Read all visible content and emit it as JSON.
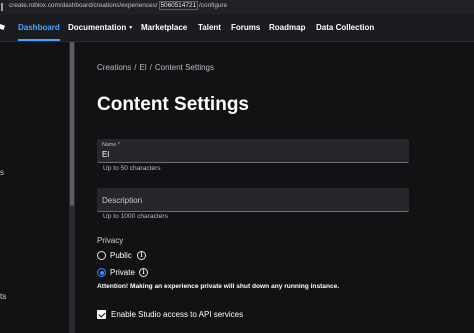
{
  "browser": {
    "url_prefix": "create.roblox.com/dashboard/creations/experiences/",
    "url_highlight": "5060514721",
    "url_suffix": "/configure"
  },
  "nav": {
    "items": [
      {
        "label": "Dashboard",
        "active": true
      },
      {
        "label": "Documentation",
        "has_dropdown": true
      },
      {
        "label": "Marketplace"
      },
      {
        "label": "Talent"
      },
      {
        "label": "Forums"
      },
      {
        "label": "Roadmap"
      },
      {
        "label": "Data Collection"
      }
    ]
  },
  "sidebar": {
    "fragments": [
      "s",
      "ts"
    ]
  },
  "breadcrumb": [
    "Creations",
    "/",
    "El",
    "/",
    "Content Settings"
  ],
  "page_title": "Content Settings",
  "name_field": {
    "label": "Name *",
    "value": "El",
    "helper": "Up to 50 characters"
  },
  "description_field": {
    "placeholder": "Description",
    "helper": "Up to 1000 characters"
  },
  "privacy": {
    "label": "Privacy",
    "options": [
      {
        "label": "Public",
        "selected": false
      },
      {
        "label": "Private",
        "selected": true
      }
    ],
    "info_icon": "i",
    "warning": "Attention! Making an experience private will shut down any running instance."
  },
  "api_access": {
    "label": "Enable Studio access to API services",
    "checked": true
  },
  "colors": {
    "accent": "#4aa3ff",
    "radio_selected": "#3d8bff",
    "background": "#121215",
    "field": "#26272b"
  }
}
